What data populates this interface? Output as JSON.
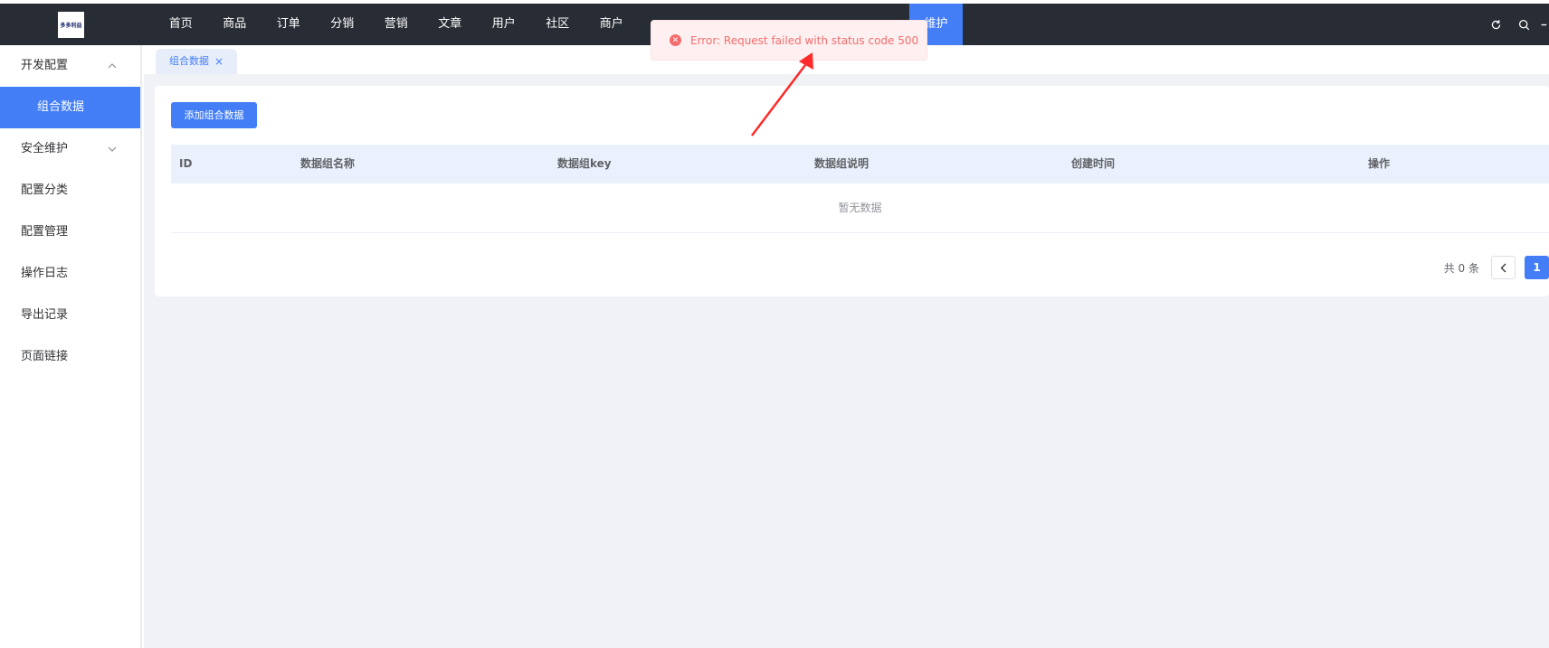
{
  "header": {
    "logo_text": "多多利益",
    "nav": [
      {
        "label": "首页"
      },
      {
        "label": "商品"
      },
      {
        "label": "订单"
      },
      {
        "label": "分销"
      },
      {
        "label": "营销"
      },
      {
        "label": "文章"
      },
      {
        "label": "用户"
      },
      {
        "label": "社区"
      },
      {
        "label": "商户"
      }
    ],
    "active_nav": "维护",
    "icons": [
      "refresh-icon",
      "search-icon"
    ]
  },
  "sidebar": {
    "items": [
      {
        "label": "开发配置",
        "expanded": true
      },
      {
        "label": "组合数据",
        "active": true
      },
      {
        "label": "安全维护",
        "expanded": false
      },
      {
        "label": "配置分类"
      },
      {
        "label": "配置管理"
      },
      {
        "label": "操作日志"
      },
      {
        "label": "导出记录"
      },
      {
        "label": "页面链接"
      }
    ]
  },
  "tabs": [
    {
      "label": "组合数据"
    }
  ],
  "main": {
    "add_button": "添加组合数据",
    "table": {
      "columns": [
        "ID",
        "数据组名称",
        "数据组key",
        "数据组说明",
        "创建时间",
        "操作"
      ],
      "empty_text": "暂无数据"
    },
    "pager": {
      "total": "共 0 条",
      "current_page": "1"
    }
  },
  "toast": {
    "type": "error",
    "message": "Error: Request failed with status code 500"
  },
  "colors": {
    "topbar": "#282c34",
    "accent": "#437ef7",
    "error": "#f56c6c",
    "annotation_arrow": "#ff2a2a"
  }
}
